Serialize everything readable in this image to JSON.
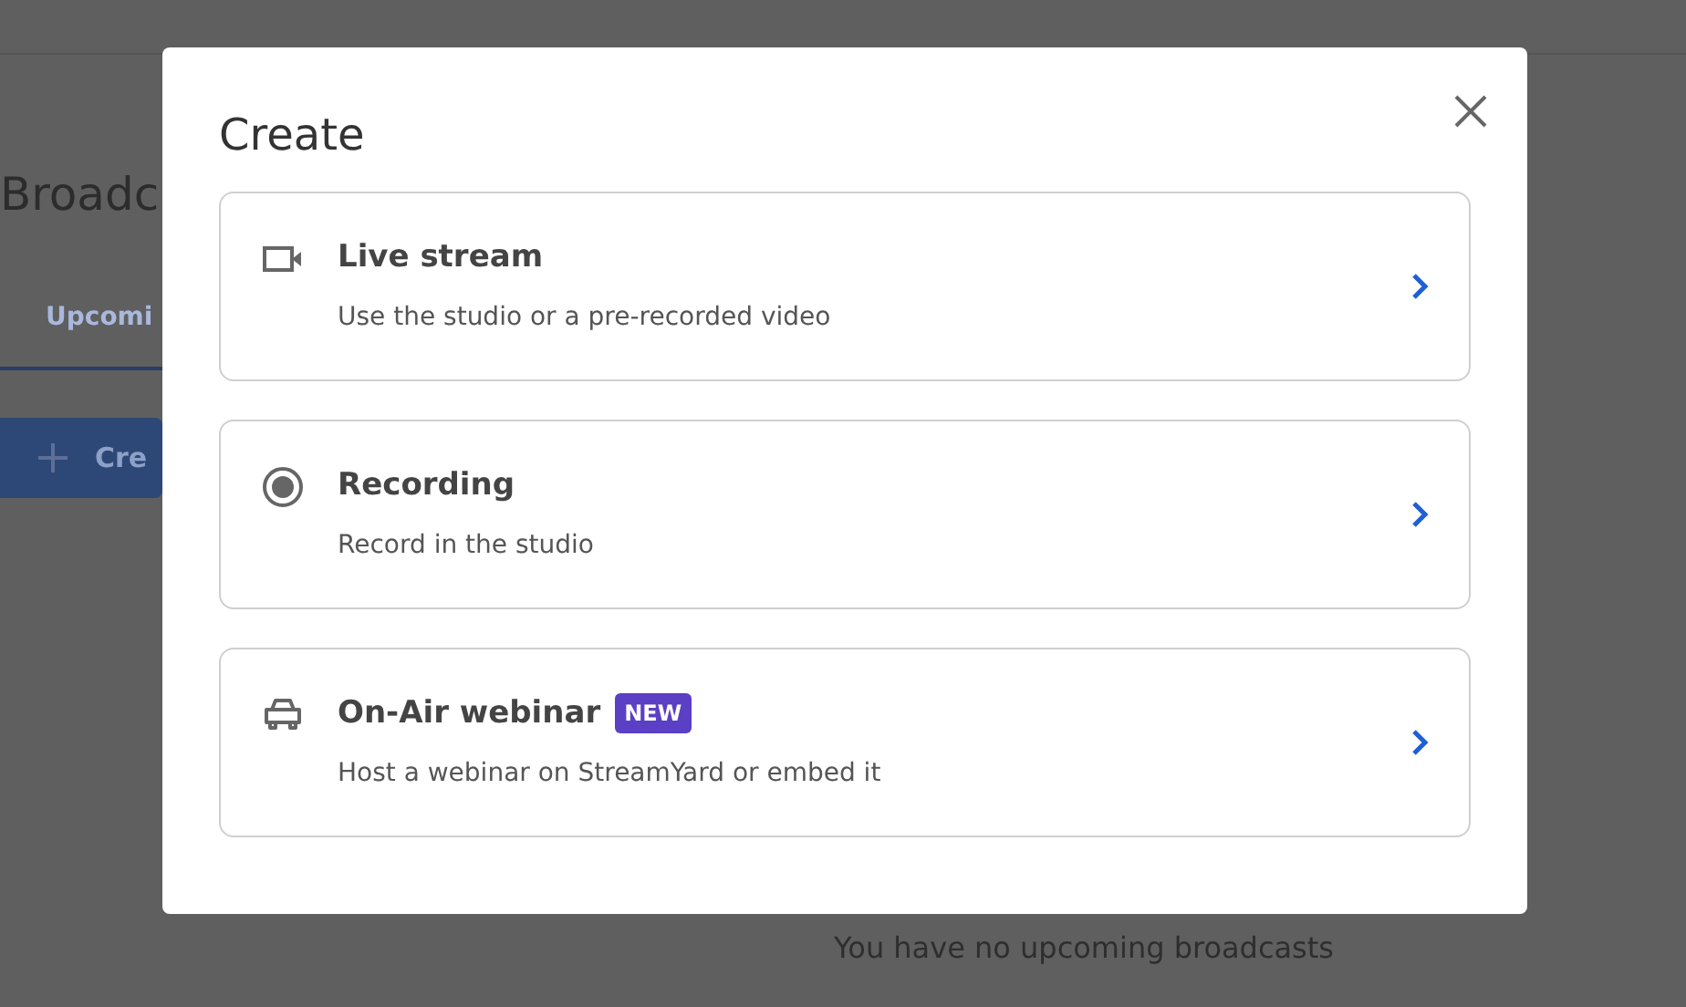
{
  "background": {
    "heading": "Broadc",
    "tabs": [
      {
        "label": "Upcomi",
        "selected": true
      }
    ],
    "create_button": {
      "label": "Cre"
    },
    "empty_message": "You have no upcoming broadcasts"
  },
  "dialog": {
    "title": "Create",
    "options": [
      {
        "kind": "camera",
        "title": "Live stream",
        "description": "Use the studio or a pre-recorded video"
      },
      {
        "kind": "record",
        "title": "Recording",
        "description": "Record in the studio"
      },
      {
        "kind": "webinar",
        "title": "On-Air webinar",
        "badge": "NEW",
        "description": "Host a webinar on StreamYard or embed it"
      }
    ]
  }
}
